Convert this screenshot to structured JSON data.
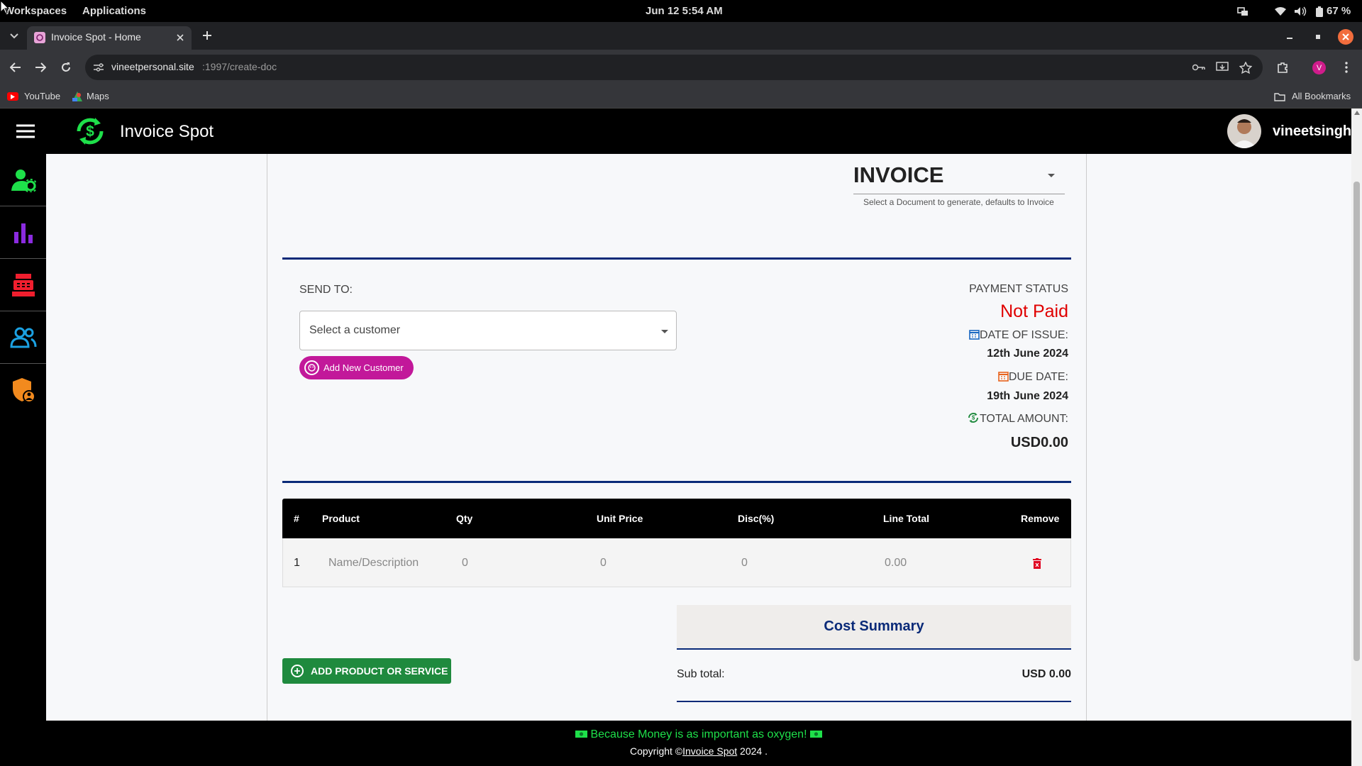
{
  "system": {
    "workspaces": "Workspaces",
    "applications": "Applications",
    "datetime": "Jun 12  5:54 AM",
    "battery": "67 %"
  },
  "browser": {
    "tab_title": "Invoice Spot - Home",
    "url_host": "vineetpersonal.site",
    "url_path": ":1997/create-doc",
    "profile_letter": "V",
    "bookmarks": [
      "YouTube",
      "Maps"
    ],
    "all_bookmarks": "All Bookmarks"
  },
  "app": {
    "title": "Invoice Spot",
    "username": "vineetsingh"
  },
  "sidebar": {
    "icons": [
      "user-settings-icon",
      "bar-chart-icon",
      "cash-register-icon",
      "users-icon",
      "shield-user-icon"
    ]
  },
  "document": {
    "type": "INVOICE",
    "helper": "Select a Document to generate, defaults to Invoice"
  },
  "send_to": {
    "label": "SEND TO:",
    "placeholder": "Select a customer",
    "add_button": "Add New Customer"
  },
  "payment": {
    "status_label": "PAYMENT STATUS",
    "status_value": "Not Paid",
    "issue_label": "DATE OF ISSUE:",
    "issue_value": "12th June 2024",
    "due_label": "DUE DATE:",
    "due_value": "19th June 2024",
    "total_label": "TOTAL AMOUNT:",
    "total_value": "USD0.00"
  },
  "table": {
    "headers": [
      "#",
      "Product",
      "Qty",
      "Unit Price",
      "Disc(%)",
      "Line Total",
      "Remove"
    ],
    "row": {
      "index": "1",
      "product_placeholder": "Name/Description",
      "qty": "0",
      "unit_price": "0",
      "disc": "0",
      "line_total": "0.00"
    }
  },
  "add_product_button": "ADD PRODUCT OR SERVICE",
  "cost_summary": {
    "title": "Cost Summary",
    "subtotal_label": "Sub total:",
    "subtotal_value": "USD 0.00"
  },
  "footer": {
    "tagline": "Because Money is as important as oxygen!",
    "copyright_prefix": "Copyright ©",
    "copyright_link": "Invoice Spot",
    "copyright_suffix": " 2024 ."
  },
  "colors": {
    "accent_green": "#1ee04a",
    "brand_blue": "#0a2a78",
    "status_red": "#e00000",
    "magenta": "#c2189a",
    "button_green": "#1f8a3e"
  }
}
